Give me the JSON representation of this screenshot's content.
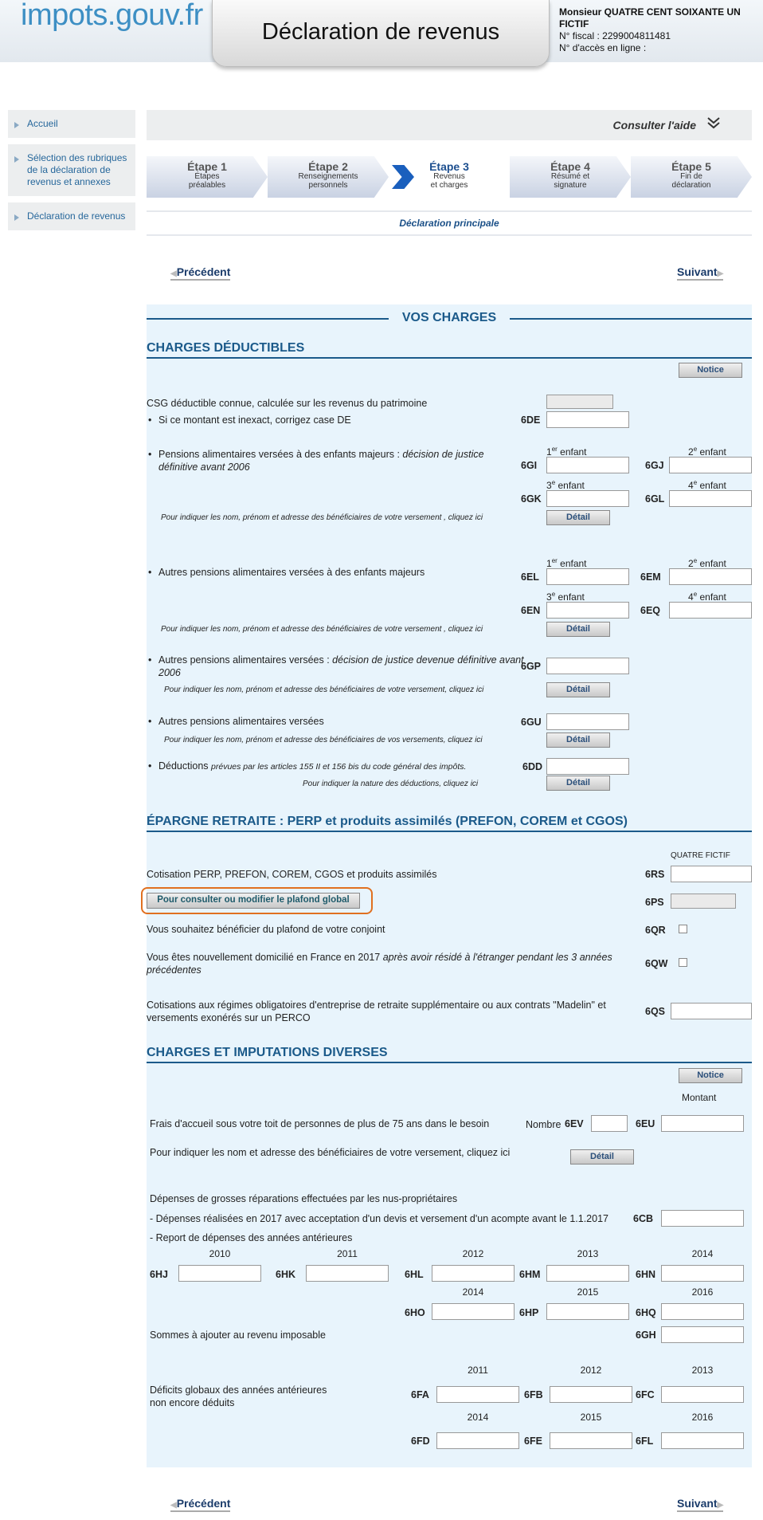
{
  "header": {
    "logo": "impots.gouv.fr",
    "title": "Déclaration de revenus",
    "user_name": "Monsieur QUATRE CENT SOIXANTE UN FICTIF",
    "fiscal_no": "N° fiscal : 2299004811481",
    "access_no": "N° d'accès en ligne :"
  },
  "sidebar": {
    "items": [
      {
        "label": "Accueil"
      },
      {
        "label": "Sélection des rubriques de la déclaration de revenus et annexes"
      },
      {
        "label": "Déclaration de revenus"
      }
    ]
  },
  "help": {
    "label": "Consulter l'aide"
  },
  "steps": [
    {
      "title": "Étape 1",
      "sub1": "Étapes",
      "sub2": "préalables"
    },
    {
      "title": "Étape 2",
      "sub1": "Renseignements",
      "sub2": "personnels"
    },
    {
      "title": "Étape 3",
      "sub1": "Revenus",
      "sub2": "et charges"
    },
    {
      "title": "Étape 4",
      "sub1": "Résumé et",
      "sub2": "signature"
    },
    {
      "title": "Étape 5",
      "sub1": "Fin de",
      "sub2": "déclaration"
    }
  ],
  "section_title": "Déclaration principale",
  "nav": {
    "prev": "Précédent",
    "next": "Suivant"
  },
  "vos_charges": "VOS CHARGES",
  "charges": {
    "title": "CHARGES DÉDUCTIBLES",
    "notice": "Notice",
    "csg": "CSG déductible connue, calculée sur les revenus du patrimoine",
    "csg_fix": "Si ce montant est inexact, corrigez case DE",
    "c_6de": "6DE",
    "pens1_a": "Pensions alimentaires versées à des enfants majeurs : ",
    "pens1_b": "décision de justice définitive avant 2006",
    "enf1": "1",
    "enf1s": "er",
    "enf2": "2",
    "enf2s": "e",
    "enf3": "3",
    "enf3s": "e",
    "enf4": "4",
    "enf4s": "e",
    "enfant": " enfant",
    "c_6gi": "6GI",
    "c_6gj": "6GJ",
    "c_6gk": "6GK",
    "c_6gl": "6GL",
    "note_benef": "Pour indiquer les nom, prénom et adresse des bénéficiaires de votre versement , cliquez ici",
    "detail": "Détail",
    "pens2": "Autres pensions alimentaires versées à des enfants majeurs",
    "c_6el": "6EL",
    "c_6em": "6EM",
    "c_6en": "6EN",
    "c_6eq": "6EQ",
    "pens3_a": "Autres pensions alimentaires versées : ",
    "pens3_b": "décision de justice devenue définitive avant 2006",
    "c_6gp": "6GP",
    "note_benef2": "Pour indiquer les nom, prénom et adresse des bénéficiaires de votre versement, cliquez ici",
    "pens4": "Autres pensions alimentaires versées",
    "c_6gu": "6GU",
    "note_benef3": "Pour indiquer les nom, prénom et adresse des bénéficiaires de vos versements, cliquez ici",
    "ded_a": "Déductions ",
    "ded_b": "prévues par les articles 155 II et 156 bis du code général des impôts.",
    "c_6dd": "6DD",
    "note_ded": "Pour indiquer la nature des déductions, cliquez ici"
  },
  "epargne": {
    "title": "ÉPARGNE RETRAITE : PERP et produits assimilés (PREFON, COREM et CGOS)",
    "col": "QUATRE FICTIF",
    "cotis": "Cotisation PERP, PREFON, COREM, CGOS et produits assimilés",
    "c_6rs": "6RS",
    "plafond_btn": "Pour consulter ou modifier le plafond global",
    "c_6ps": "6PS",
    "conjoint": "Vous souhaitez bénéficier du plafond de votre conjoint",
    "c_6qr": "6QR",
    "domicile_a": "Vous êtes nouvellement domicilié en France en 2017 ",
    "domicile_b": "après avoir résidé à l'étranger pendant les 3 années précédentes",
    "c_6qw": "6QW",
    "regimes": "Cotisations aux régimes obligatoires d'entreprise de retraite supplémentaire ou aux contrats \"Madelin\" et versements exonérés sur un PERCO",
    "c_6qs": "6QS"
  },
  "diverses": {
    "title": "CHARGES ET IMPUTATIONS DIVERSES",
    "notice": "Notice",
    "montant": "Montant",
    "frais": "Frais d'accueil sous votre toit de personnes de plus de 75 ans dans le besoin",
    "nombre": "Nombre",
    "c_6ev": "6EV",
    "c_6eu": "6EU",
    "note": "Pour indiquer les nom et adresse des bénéficiaires de votre versement, cliquez ici",
    "detail": "Détail",
    "grosses": "Dépenses de grosses réparations effectuées par les nus-propriétaires",
    "realisees": "- Dépenses réalisées en 2017 avec acceptation d'un devis et versement d'un acompte avant le 1.1.2017",
    "c_6cb": "6CB",
    "report": "- Report de dépenses des années antérieures",
    "years1": [
      "2010",
      "2011",
      "2012",
      "2013",
      "2014"
    ],
    "codes1": [
      "6HJ",
      "6HK",
      "6HL",
      "6HM",
      "6HN"
    ],
    "years2": [
      "2014",
      "2015",
      "2016"
    ],
    "codes2": [
      "6HO",
      "6HP",
      "6HQ"
    ],
    "sommes": "Sommes à ajouter au revenu imposable",
    "c_6gh": "6GH",
    "deficits": "Déficits globaux des années antérieures non encore déduits",
    "years3": [
      "2011",
      "2012",
      "2013"
    ],
    "codes3": [
      "6FA",
      "6FB",
      "6FC"
    ],
    "years4": [
      "2014",
      "2015",
      "2016"
    ],
    "codes4": [
      "6FD",
      "6FE",
      "6FL"
    ]
  }
}
